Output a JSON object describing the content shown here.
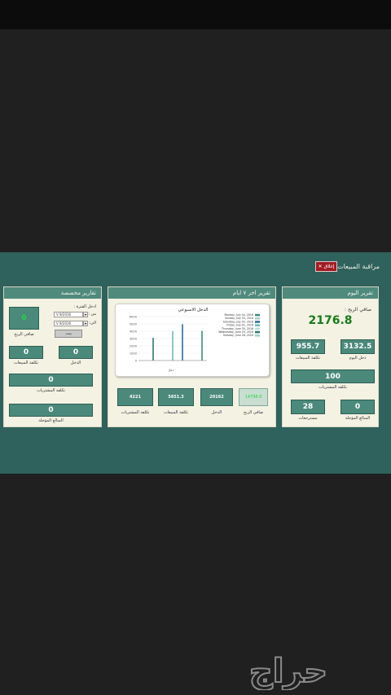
{
  "window": {
    "title": "مراقبة المبيعات",
    "close_label": "إغلاق"
  },
  "today": {
    "header": "تقرير اليوم",
    "profit_label": "صافي الربح :",
    "profit_value": "2176.8",
    "tiles": [
      {
        "label": "دخل اليوم",
        "value": "3132.5"
      },
      {
        "label": "تكلفة المبيعات",
        "value": "955.7"
      }
    ],
    "purchases": {
      "label": "تكلفة المشتريات",
      "value": "100"
    },
    "bottom": [
      {
        "label": "المبالغ المؤجلة",
        "value": "0"
      },
      {
        "label": "مسترجعات",
        "value": "28"
      }
    ]
  },
  "week": {
    "header": "تقرير اخر ٧ ايام",
    "tiles": [
      {
        "label": "صافي الربح",
        "value": "14798.9"
      },
      {
        "label": "الدخل",
        "value": "20162"
      },
      {
        "label": "تكلفة المبيعات",
        "value": "5651.3"
      },
      {
        "label": "تكلفة المشتريات",
        "value": "4221"
      }
    ]
  },
  "custom": {
    "header": "تقارير مخصصة",
    "period_label": "ادخل الفترة :",
    "from_label": "من :",
    "to_label": "الى:",
    "from_date": "V 9/2016",
    "to_date": "V 9/2016",
    "search_label": "بحث",
    "profit": {
      "label": "صافي الربح",
      "value": "0"
    },
    "pair": [
      {
        "label": "الدخل",
        "value": "0"
      },
      {
        "label": "تكلفة المبيعات",
        "value": "0"
      }
    ],
    "purchases": {
      "label": "تكلفة المشتريات",
      "value": "0"
    },
    "deferred": {
      "label": "المبالغ المؤجلة",
      "value": "0"
    }
  },
  "chart_data": {
    "type": "bar",
    "title": "الدخل الاسبوعي",
    "xlabel": "دخل",
    "ylabel": "",
    "ylim": [
      0,
      6000
    ],
    "yticks": [
      "6000",
      "5000",
      "4000",
      "3000",
      "2000",
      "1000",
      "0"
    ],
    "legend_position": "right",
    "series": [
      {
        "name": "Tuesday, June 28, 2016",
        "value": 0,
        "color": "#9ed3c7"
      },
      {
        "name": "Wednesday, June 29, 2016",
        "value": 3100,
        "color": "#2e7a70"
      },
      {
        "name": "Thursday, June 30, 2016",
        "value": 0,
        "color": "#b9ddd5"
      },
      {
        "name": "Friday, July 01, 2016",
        "value": 4000,
        "color": "#6fbcae"
      },
      {
        "name": "Saturday, July 02, 2016",
        "value": 4950,
        "color": "#2f6d9b"
      },
      {
        "name": "Sunday, July 03, 2016",
        "value": 0,
        "color": "#a7d0c6"
      },
      {
        "name": "Monday, July 04, 2016",
        "value": 4050,
        "color": "#3e8b7f"
      }
    ]
  },
  "watermark": {
    "text": "حراج"
  }
}
